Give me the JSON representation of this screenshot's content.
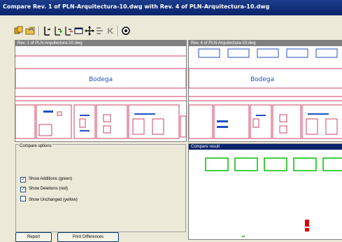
{
  "window": {
    "title": "Compare Rev. 1 of PLN-Arquitectura-10.dwg with Rev. 4 of PLN-Arquitectura-10.dwg"
  },
  "toolbar": {
    "icons": [
      "save-compare-icon",
      "open-folder-icon",
      "pointer-icon",
      "pointer-add-icon",
      "pointer-delete-icon",
      "zoom-window-icon",
      "pan-icon",
      "sync-panes-icon",
      "previous-icon",
      "print-icon"
    ]
  },
  "left_pane": {
    "title": "Rev. 1 of PLN-Arquitectura-10.dwg",
    "room_label": "Bodega"
  },
  "right_pane": {
    "title": "Rev. 4 of PLN-Arquitectura-10.dwg",
    "room_label": "Bodega"
  },
  "result_pane": {
    "title": "Compare result"
  },
  "compare_options": {
    "title": "Compare options",
    "options": [
      {
        "label": "Show Additions (green)",
        "checked": true
      },
      {
        "label": "Show Deletions (red)",
        "checked": true
      },
      {
        "label": "Show Unchanged (yellow)",
        "checked": false
      }
    ]
  },
  "buttons": {
    "report": "Report",
    "print_differences": "Print Differences"
  },
  "colors": {
    "addition": "#00c000",
    "deletion": "#e00000",
    "drawing_line": "#d04060",
    "drawing_blue": "#2050c0",
    "title_blue": "#0a246a"
  }
}
